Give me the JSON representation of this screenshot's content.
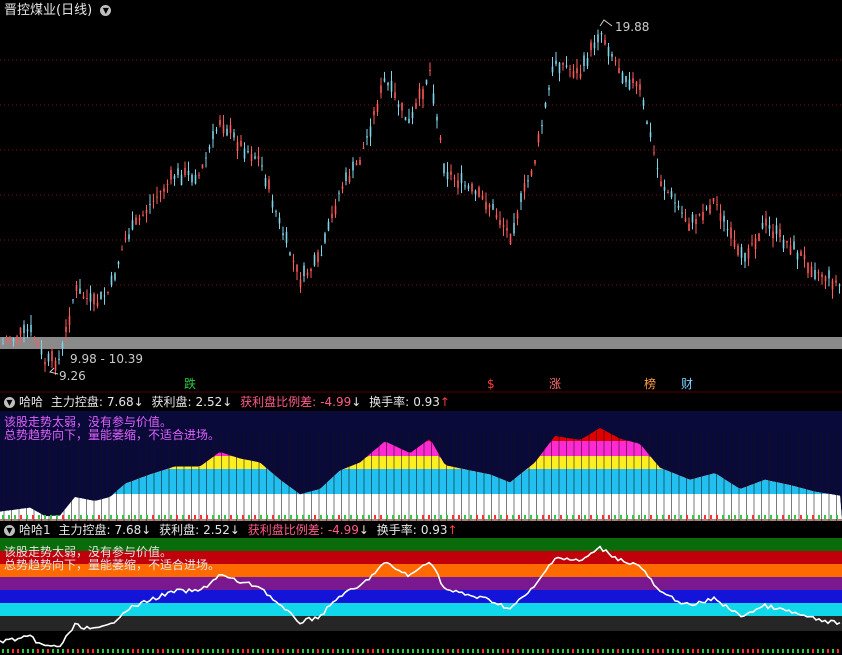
{
  "main": {
    "title": "晋控煤业(日线)",
    "high_label": "19.88",
    "low_label": "9.26",
    "range_label": "9.98 - 10.39",
    "markers": [
      {
        "text": "跌",
        "color": "#2ecc40"
      },
      {
        "text": "$",
        "color": "#ff3b3b"
      },
      {
        "text": "涨",
        "color": "#ff6b6b"
      },
      {
        "text": "榜",
        "color": "#ff9f43"
      },
      {
        "text": "财",
        "color": "#7fd3ff"
      }
    ]
  },
  "panel1": {
    "name": "哈哈",
    "main_force_label": "主力控盘:",
    "main_force_value": "7.68",
    "profit_label": "获利盘:",
    "profit_value": "2.52",
    "ratio_label": "获利盘比例差:",
    "ratio_value": "-4.99",
    "turnover_label": "换手率:",
    "turnover_value": "0.93",
    "note1": "该股走势太弱，没有参与价值。",
    "note2": "总势趋势向下，量能萎缩，不适合进场。",
    "arrow_down": "↓",
    "arrow_up": "↑"
  },
  "panel2": {
    "name": "哈哈1",
    "main_force_label": "主力控盘:",
    "main_force_value": "7.68",
    "profit_label": "获利盘:",
    "profit_value": "2.52",
    "ratio_label": "获利盘比例差:",
    "ratio_value": "-4.99",
    "turnover_label": "换手率:",
    "turnover_value": "0.93",
    "note1": "该股走势太弱，没有参与价值。",
    "note2": "总势趋势向下，量能萎缩，不适合进场。",
    "arrow_down": "↓",
    "arrow_up": "↑"
  },
  "colors": {
    "up": "#ff5a5a",
    "down": "#7fd3e8",
    "grid": "#7a1212",
    "label_white": "#e6e6e6",
    "label_pink": "#ff5a8a",
    "arrow_up": "#ff3b3b",
    "note_pink": "#e060ff"
  }
}
